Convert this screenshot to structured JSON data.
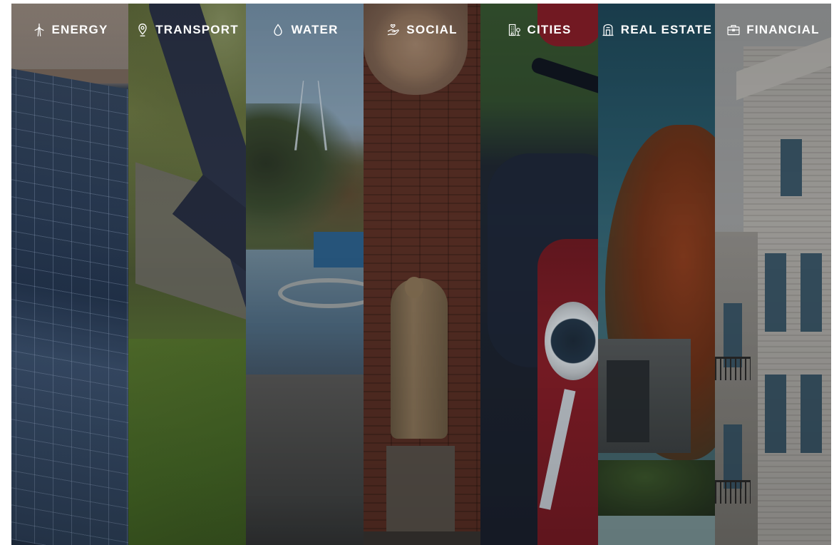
{
  "categories": [
    {
      "key": "energy",
      "label": "ENERGY",
      "icon": "wind-turbine-icon"
    },
    {
      "key": "transport",
      "label": "TRANSPORT",
      "icon": "map-pin-icon"
    },
    {
      "key": "water",
      "label": "WATER",
      "icon": "water-drop-icon"
    },
    {
      "key": "social",
      "label": "SOCIAL",
      "icon": "helping-hand-icon"
    },
    {
      "key": "cities",
      "label": "CITIES",
      "icon": "city-buildings-icon"
    },
    {
      "key": "realestate",
      "label": "REAL ESTATE",
      "icon": "building-door-icon"
    },
    {
      "key": "financial",
      "label": "FINANCIAL",
      "icon": "briefcase-icon"
    }
  ]
}
